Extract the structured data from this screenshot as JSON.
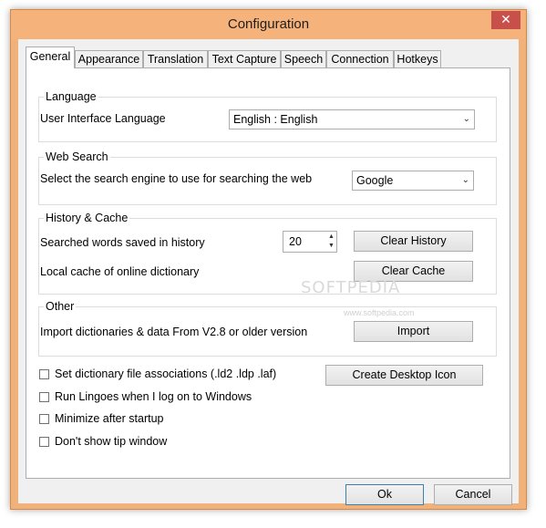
{
  "window": {
    "title": "Configuration",
    "close_glyph": "✕"
  },
  "tabs": [
    {
      "label": "General",
      "active": true
    },
    {
      "label": "Appearance"
    },
    {
      "label": "Translation"
    },
    {
      "label": "Text Capture"
    },
    {
      "label": "Speech"
    },
    {
      "label": "Connection"
    },
    {
      "label": "Hotkeys"
    }
  ],
  "language": {
    "title": "Language",
    "label": "User Interface Language",
    "value": "English  :  English"
  },
  "web_search": {
    "title": "Web Search",
    "label": "Select the search engine to use for searching the web",
    "value": "Google"
  },
  "history": {
    "title": "History & Cache",
    "saved_label": "Searched words saved in history",
    "saved_value": "20",
    "clear_history": "Clear History",
    "cache_label": "Local cache of online dictionary",
    "clear_cache": "Clear Cache"
  },
  "other": {
    "title": "Other",
    "label": "Import dictionaries & data From V2.8 or older version",
    "import": "Import"
  },
  "options": [
    {
      "label": "Set dictionary file associations (.ld2 .ldp .laf)",
      "checked": false
    },
    {
      "label": "Run Lingoes when I log on to Windows",
      "checked": false
    },
    {
      "label": "Minimize after startup",
      "checked": false
    },
    {
      "label": "Don't show tip window",
      "checked": false
    }
  ],
  "create_icon": "Create Desktop Icon",
  "watermark": {
    "text": "SOFTPEDIA",
    "sub": "www.softpedia.com"
  },
  "footer": {
    "ok": "Ok",
    "cancel": "Cancel"
  },
  "colors": {
    "frame": "#f0b27a",
    "close": "#c7504a",
    "focus_border": "#3c7fb1"
  }
}
